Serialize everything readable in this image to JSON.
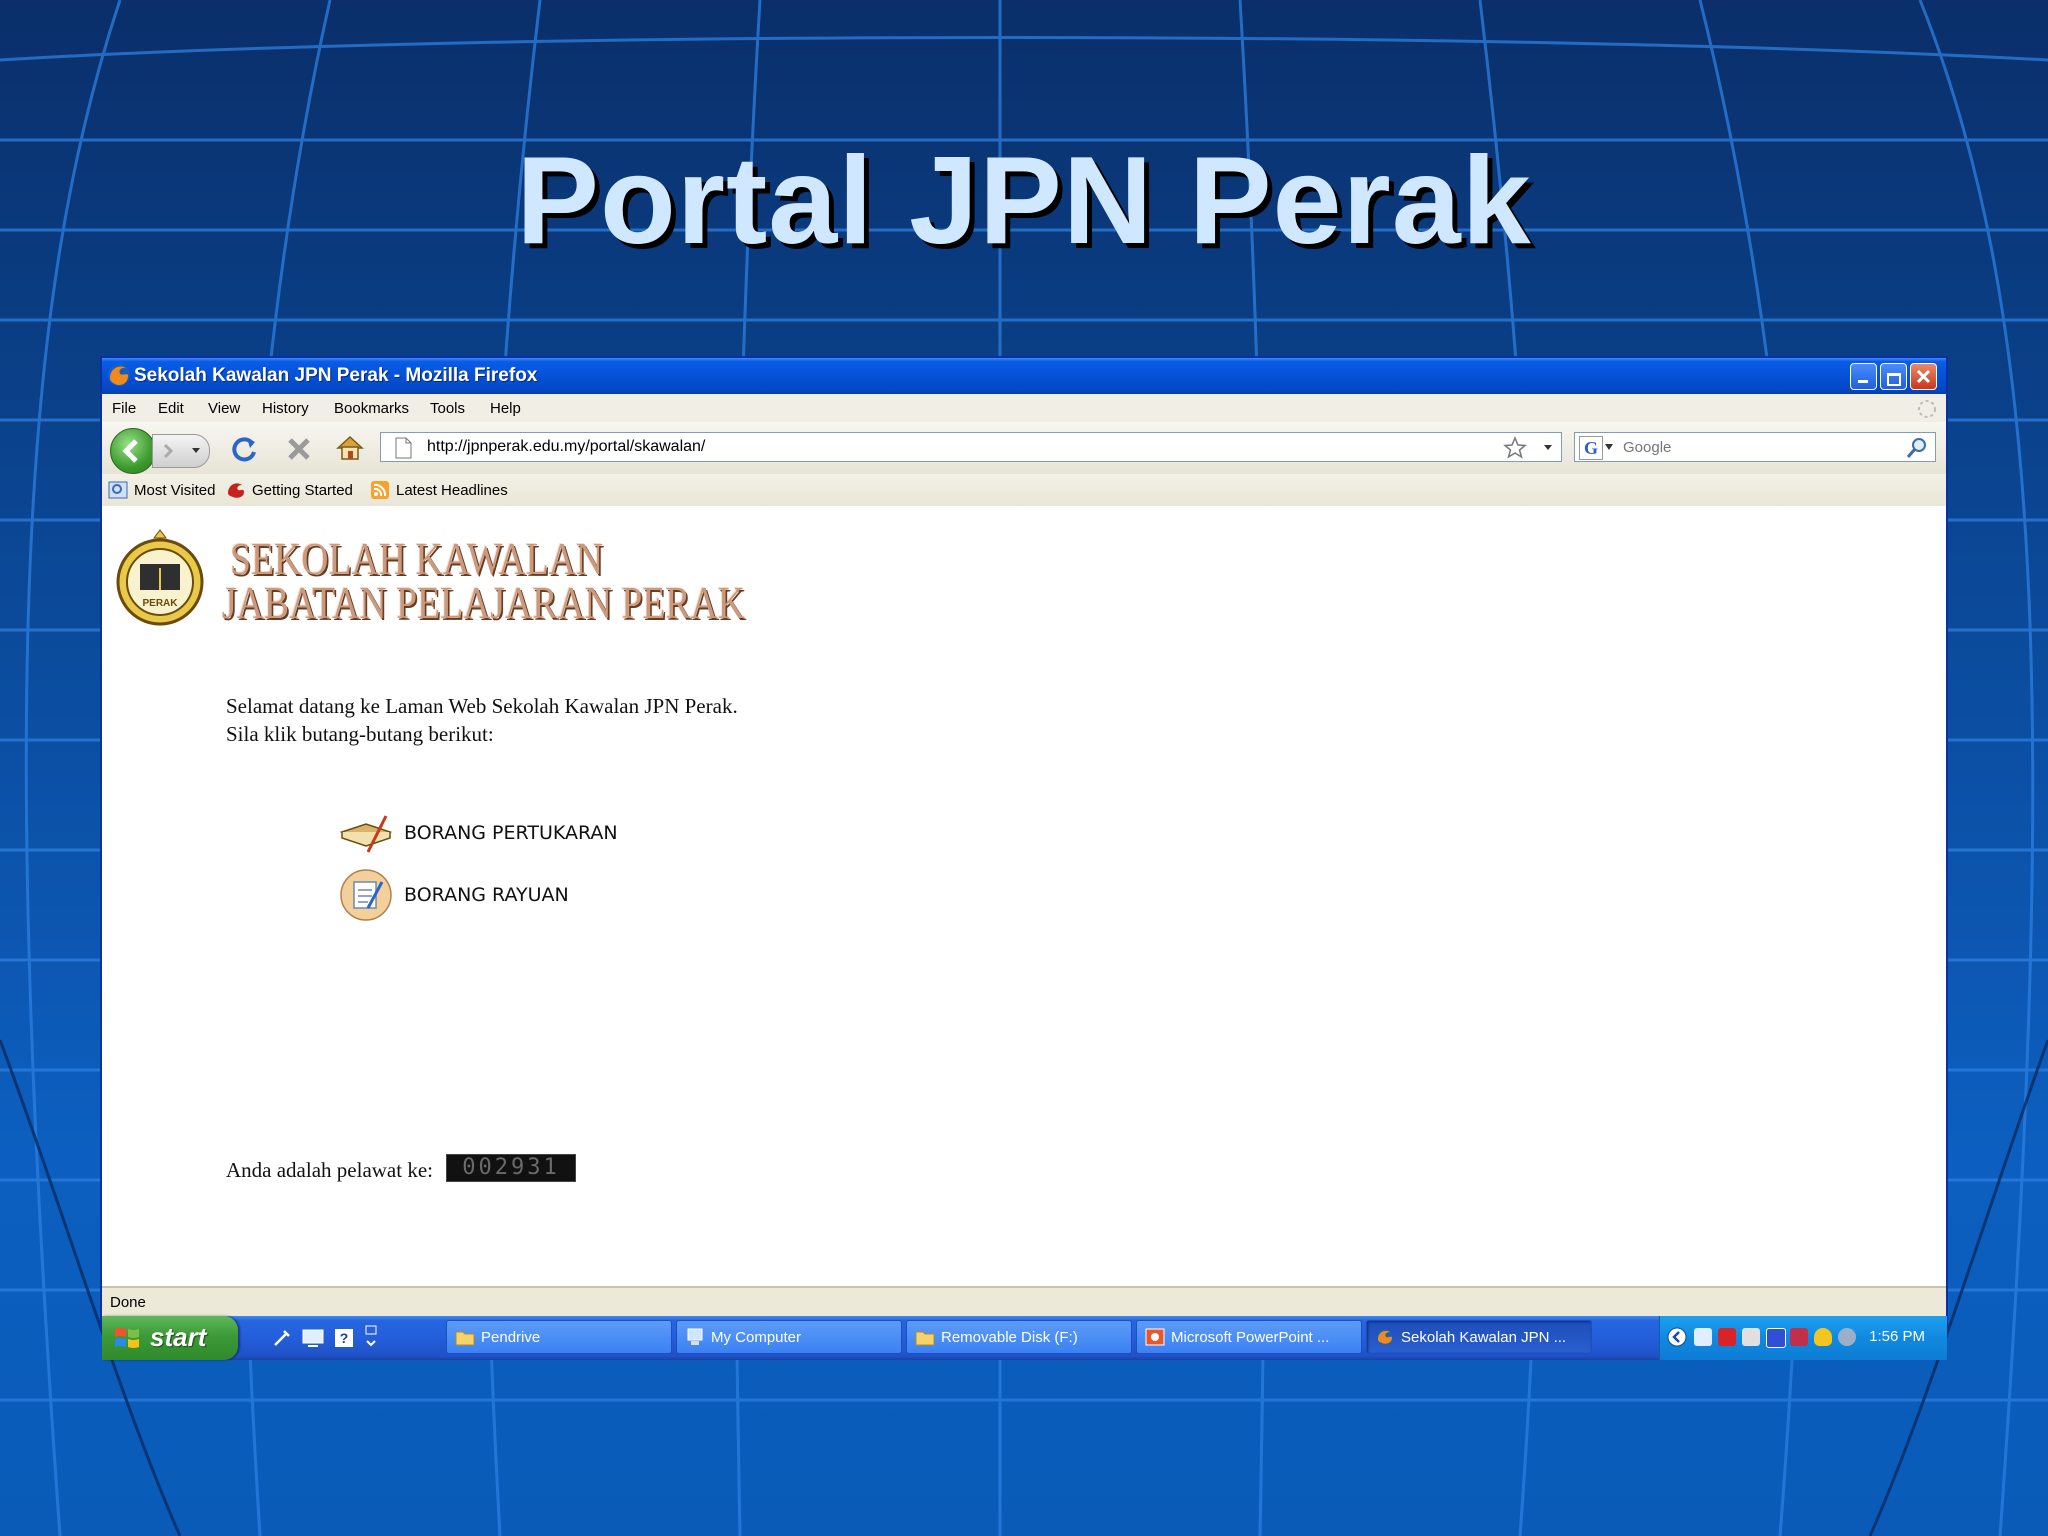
{
  "slide": {
    "title": "Portal JPN Perak"
  },
  "window": {
    "title": "Sekolah Kawalan JPN Perak - Mozilla Firefox"
  },
  "menu": {
    "items": [
      {
        "label": "File",
        "key": "F",
        "rest": "ile"
      },
      {
        "label": "Edit",
        "key": "E",
        "rest": "dit"
      },
      {
        "label": "View",
        "key": "V",
        "rest": "iew"
      },
      {
        "label": "History",
        "key": "",
        "rest": "History"
      },
      {
        "label": "Bookmarks",
        "key": "B",
        "rest": "ookmarks"
      },
      {
        "label": "Tools",
        "key": "T",
        "rest": "ools"
      },
      {
        "label": "Help",
        "key": "H",
        "rest": "elp"
      }
    ]
  },
  "navigation": {
    "url": "http://jpnperak.edu.my/portal/skawalan/",
    "search_placeholder": "Google"
  },
  "bookmarks": [
    {
      "label": "Most Visited",
      "icon": "most-visited-icon"
    },
    {
      "label": "Getting Started",
      "icon": "firefox-icon"
    },
    {
      "label": "Latest Headlines",
      "icon": "rss-icon"
    }
  ],
  "page": {
    "logo_line1": "SEKOLAH KAWALAN",
    "logo_line2": "JABATAN PELAJARAN PERAK",
    "emblem_text": "PERAK",
    "welcome_line1": "Selamat datang ke Laman Web Sekolah Kawalan JPN Perak.",
    "welcome_line2": "Sila klik butang-butang berikut:",
    "link1": "BORANG PERTUKARAN",
    "link2": "BORANG RAYUAN",
    "visitor_label": "Anda adalah pelawat ke:",
    "visitor_count": "002931"
  },
  "status": {
    "text": "Done"
  },
  "taskbar": {
    "start_label": "start",
    "tasks": [
      {
        "label": "Pendrive",
        "icon": "folder-icon"
      },
      {
        "label": "My Computer",
        "icon": "computer-icon"
      },
      {
        "label": "Removable Disk (F:)",
        "icon": "folder-icon"
      },
      {
        "label": "Microsoft PowerPoint ...",
        "icon": "powerpoint-icon"
      },
      {
        "label": "Sekolah Kawalan JPN ...",
        "icon": "firefox-icon"
      }
    ],
    "clock": "1:56 PM"
  },
  "colors": {
    "slide_title": "#cfe8ff",
    "titlebar": "#0551d8",
    "taskbar": "#245edb",
    "start_button": "#3c9a37"
  }
}
